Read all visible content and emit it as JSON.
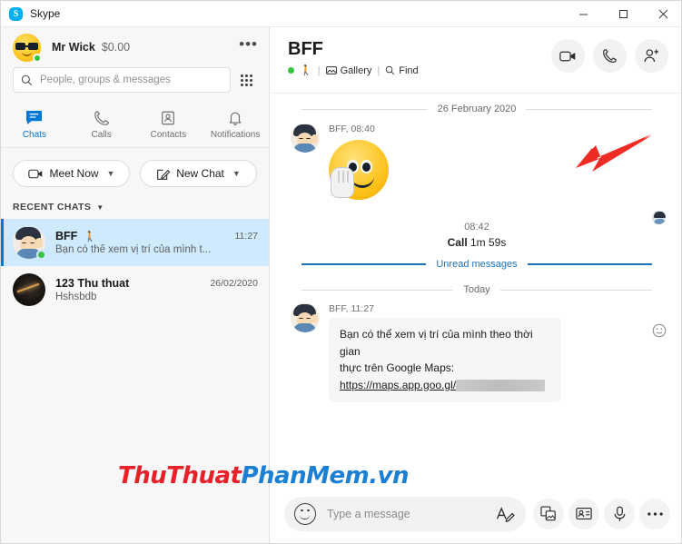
{
  "window": {
    "app_title": "Skype",
    "logo_letter": "S",
    "controls": {
      "minimize": "minimize-icon",
      "maximize": "maximize-icon",
      "close": "close-icon"
    }
  },
  "sidebar": {
    "profile": {
      "name": "Mr Wick",
      "balance": "$0.00",
      "status": "online",
      "more_label": "•••",
      "avatar_icon": "sunglasses-emoji-avatar"
    },
    "search": {
      "placeholder": "People, groups & messages",
      "icon": "search-icon",
      "dialpad_icon": "dialpad-icon"
    },
    "tabs": [
      {
        "label": "Chats",
        "icon": "chat-bubble-icon",
        "active": true
      },
      {
        "label": "Calls",
        "icon": "phone-icon",
        "active": false
      },
      {
        "label": "Contacts",
        "icon": "contact-card-icon",
        "active": false
      },
      {
        "label": "Notifications",
        "icon": "bell-icon",
        "active": false
      }
    ],
    "actions": [
      {
        "label": "Meet Now",
        "icon": "video-camera-icon",
        "chevron": "chevron-down-icon"
      },
      {
        "label": "New Chat",
        "icon": "compose-pencil-icon",
        "chevron": "chevron-down-icon"
      }
    ],
    "recent_header": {
      "label": "RECENT CHATS",
      "chevron": "chevron-down-icon"
    },
    "chats": [
      {
        "name": "BFF",
        "badge_icon": "walking-person-icon",
        "time": "11:27",
        "preview": "Bạn có thể xem vị trí của mình t...",
        "selected": true,
        "status": "online"
      },
      {
        "name": "123 Thu thuat",
        "badge_icon": "",
        "time": "26/02/2020",
        "preview": "Hshsbdb",
        "selected": false,
        "status": "none"
      }
    ]
  },
  "chat": {
    "title": "BFF",
    "status_icon": "online-dot-icon",
    "walking_icon": "walking-person-icon",
    "separator": "|",
    "gallery": {
      "label": "Gallery",
      "icon": "gallery-icon"
    },
    "find": {
      "label": "Find",
      "icon": "search-icon"
    },
    "actions": [
      {
        "name": "video-call-button",
        "icon": "video-camera-icon"
      },
      {
        "name": "audio-call-button",
        "icon": "phone-icon"
      },
      {
        "name": "add-people-button",
        "icon": "add-person-icon"
      }
    ],
    "dividers": {
      "date": "26 February 2020",
      "unread": "Unread messages",
      "today": "Today"
    },
    "messages": [
      {
        "sender": "BFF",
        "time": "08:40",
        "meta": "BFF, 08:40",
        "type": "emoji",
        "emoji_name": "wave-hand-emoji"
      },
      {
        "sender": "BFF",
        "time": "11:27",
        "meta": "BFF, 11:27",
        "type": "text",
        "line1": "Bạn có thể xem vị trí của mình theo thời gian",
        "line2": "thực trên Google Maps:",
        "link": "https://maps.app.goo.gl/",
        "link_redacted": true,
        "react_icon": "emoji-reaction-icon"
      }
    ],
    "call_event": {
      "time": "08:42",
      "label": "Call",
      "duration": "1m 59s"
    },
    "read_receipt_icon": "read-receipt-avatar"
  },
  "compose": {
    "emoji_icon": "emoji-smiley-icon",
    "placeholder": "Type a message",
    "format_icon": "text-format-icon",
    "buttons": [
      {
        "name": "send-image-button",
        "icon": "image-icon"
      },
      {
        "name": "send-contact-button",
        "icon": "contact-card-icon"
      },
      {
        "name": "voice-message-button",
        "icon": "microphone-icon"
      },
      {
        "name": "more-options-button",
        "icon": "ellipsis-icon"
      }
    ]
  },
  "annotation": {
    "arrow_icon": "red-arrow-icon",
    "arrow_color": "#ee2b24"
  },
  "watermark": {
    "part1": "ThuThuat",
    "part2": "PhanMem.vn",
    "color1": "#e8202a",
    "color2": "#1b7fd4"
  },
  "colors": {
    "accent": "#0078d4",
    "skype_blue": "#00aff0",
    "selected_chat": "#cfeafc",
    "online_green": "#35c43d",
    "unread_line": "#1a72b8"
  }
}
